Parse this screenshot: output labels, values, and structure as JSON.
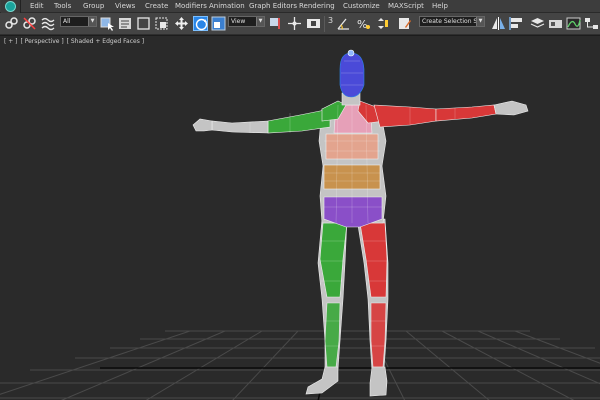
{
  "menubar": {
    "items": [
      "Edit",
      "Tools",
      "Group",
      "Views",
      "Create",
      "Modifiers",
      "Animation",
      "Graph Editors",
      "Rendering",
      "Customize",
      "MAXScript",
      "Help"
    ]
  },
  "toolbar": {
    "selection_filter": "All",
    "reference_coord": "View",
    "snap_number": "3",
    "named_selection_placeholder": "Create Selection S"
  },
  "viewport": {
    "plus_menu": "[ + ]",
    "view_name": "[ Perspective ]",
    "shading_mode": "[ Shaded + Edged Faces ]"
  },
  "colors": {
    "menubar_bg": "#3d3d3d",
    "toolbar_bg": "#444444",
    "viewport_bg": "#2a2a2a",
    "grid_line": "#4a4a4a",
    "grid_axis": "#0a0a0a",
    "body_mesh": "#c4c4c4",
    "head_selection": "#4a4ad8",
    "left_limbs": "#3aa83a",
    "right_limbs": "#d83838",
    "chest": "#e6a0b8",
    "abdomen": "#e3a48e",
    "waist": "#c8924e",
    "pelvis": "#8a4fc8",
    "selection_highlight": "#2a86e8"
  },
  "icons": [
    "select-link-icon",
    "unlink-icon",
    "bind-spacewarp-icon",
    "select-object-icon",
    "select-by-name-icon",
    "rect-region-icon",
    "window-crossing-icon",
    "move-icon",
    "rotate-icon",
    "scale-icon",
    "pivot-icon",
    "manipulate-icon",
    "keyboard-shortcut-icon",
    "snap-toggle-icon",
    "angle-snap-icon",
    "percent-snap-icon",
    "spinner-snap-icon",
    "edit-named-sets-icon",
    "mirror-icon",
    "align-icon",
    "layer-manager-icon",
    "graphite-ribbon-icon",
    "curve-editor-icon",
    "schematic-view-icon",
    "material-editor-icon",
    "render-setup-icon",
    "rendered-frame-icon",
    "render-icon"
  ]
}
